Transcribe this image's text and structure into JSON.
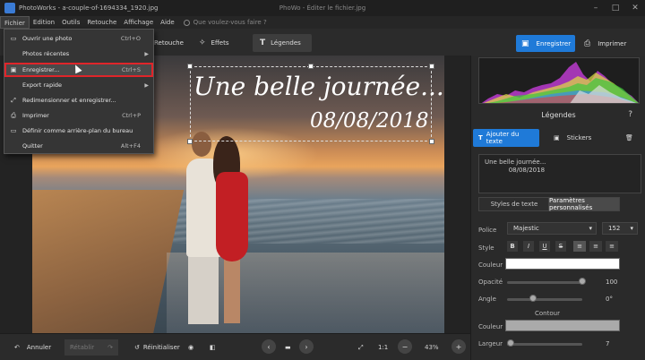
{
  "window": {
    "title": "PhotoWorks - a-couple-of-1694334_1920.jpg",
    "center_title": "PhoWo - Éditer le fichier.jpg"
  },
  "menubar": {
    "items": [
      "Fichier",
      "Edition",
      "Outils",
      "Retouche",
      "Affichage",
      "Aide"
    ],
    "search_placeholder": "Que voulez-vous faire ?"
  },
  "toolbar": {
    "tabs": [
      {
        "label": "Retouche",
        "icon": "retouch-icon"
      },
      {
        "label": "Effets",
        "icon": "effects-icon"
      },
      {
        "label": "Légendes",
        "icon": "text-icon"
      }
    ],
    "save_label": "Enregistrer",
    "print_label": "Imprimer"
  },
  "file_menu": {
    "items": [
      {
        "label": "Ouvrir une photo",
        "shortcut": "Ctrl+O",
        "icon": "folder-icon"
      },
      {
        "label": "Photos récentes",
        "shortcut": "",
        "icon": "",
        "submenu": true
      },
      {
        "label": "Enregistrer...",
        "shortcut": "Ctrl+S",
        "icon": "save-icon",
        "highlight": true
      },
      {
        "label": "Export rapide",
        "shortcut": "",
        "icon": "",
        "submenu": true
      },
      {
        "label": "Redimensionner et enregistrer...",
        "shortcut": "",
        "icon": "resize-icon"
      },
      {
        "label": "Imprimer",
        "shortcut": "Ctrl+P",
        "icon": "print-icon"
      },
      {
        "label": "Définir comme arrière-plan du bureau",
        "shortcut": "",
        "icon": "desktop-icon"
      },
      {
        "label": "Quitter",
        "shortcut": "Alt+F4",
        "icon": ""
      }
    ]
  },
  "canvas": {
    "overlay_line1": "Une belle journée...",
    "overlay_line2": "08/08/2018"
  },
  "panel": {
    "title": "Légendes",
    "help": "?",
    "add_text_label": "Ajouter du texte",
    "stickers_label": "Stickers",
    "textbox_value": "Une belle journée...\n            08/08/2018",
    "seg_styles": "Styles de texte",
    "seg_params": "Paramètres personnalisés",
    "font_label": "Police",
    "font_value": "Majestic",
    "font_size": "152",
    "style_label": "Style",
    "style_buttons": [
      "B",
      "I",
      "U",
      "S"
    ],
    "color_label": "Couleur",
    "opacity_label": "Opacité",
    "opacity_value": "100",
    "angle_label": "Angle",
    "angle_value": "0°",
    "contour_label": "Contour",
    "contour_color_label": "Couleur",
    "width_label": "Largeur",
    "width_value": "7",
    "text_color": "#ffffff",
    "contour_color": "#aaaaaa",
    "opacity_level": 1.0,
    "angle_level": 0.35,
    "width_level": 0.05
  },
  "bottombar": {
    "undo_label": "Annuler",
    "redo_label": "Rétablir",
    "reset_label": "Réinitialiser",
    "fit_label": "1:1",
    "zoom_value": "43%"
  },
  "colors": {
    "accent": "#1f7ad8",
    "highlight_border": "#e0252a"
  }
}
